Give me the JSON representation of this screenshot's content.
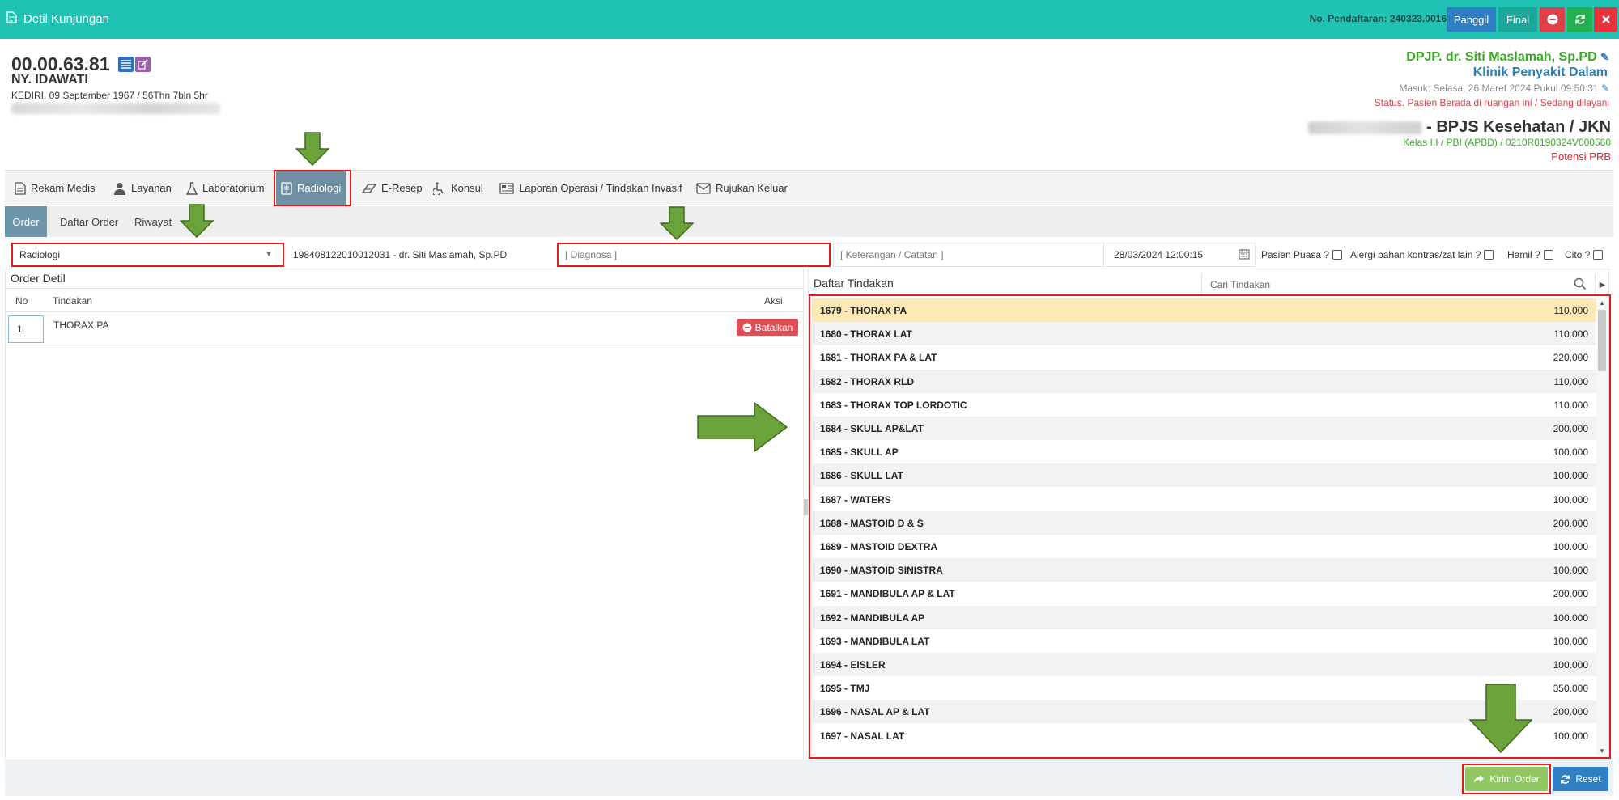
{
  "window": {
    "title": "Detil Kunjungan",
    "reg_label": "No. Pendaftaran: 240323.0016",
    "buttons": {
      "panggil": "Panggil",
      "final": "Final"
    }
  },
  "patient": {
    "rm": "00.00.63.81",
    "name": "NY. IDAWATI",
    "birth": "KEDIRI, 09 September 1967 / 56Thn 7bln 5hr"
  },
  "visit": {
    "dpjp": "DPJP. dr. Siti Maslamah, Sp.PD",
    "clinic": "Klinik Penyakit Dalam",
    "masuk": "Masuk: Selasa, 26 Maret 2024 Pukul 09:50:31",
    "status": "Status. Pasien Berada di ruangan ini / Sedang dilayani",
    "payer": "- BPJS Kesehatan / JKN",
    "kelas": "Kelas III / PBI (APBD) / 0210R0190324V000560",
    "prb": "Potensi PRB"
  },
  "tabs": [
    {
      "label": "Rekam Medis",
      "icon": "document-icon"
    },
    {
      "label": "Layanan",
      "icon": "user-doctor-icon"
    },
    {
      "label": "Laboratorium",
      "icon": "flask-icon"
    },
    {
      "label": "Radiologi",
      "icon": "xray-icon"
    },
    {
      "label": "E-Resep",
      "icon": "eraser-icon"
    },
    {
      "label": "Konsul",
      "icon": "wheelchair-icon"
    },
    {
      "label": "Laporan Operasi / Tindakan Invasif",
      "icon": "newspaper-icon"
    },
    {
      "label": "Rujukan Keluar",
      "icon": "envelope-icon"
    }
  ],
  "subtabs": [
    "Order",
    "Daftar Order",
    "Riwayat"
  ],
  "form": {
    "unit": "Radiologi",
    "doctor": "198408122010012031 - dr. Siti Maslamah, Sp.PD",
    "diagnosa_placeholder": "[ Diagnosa ]",
    "keterangan_placeholder": "[ Keterangan / Catatan ]",
    "datetime": "28/03/2024 12:00:15",
    "checks": [
      "Pasien Puasa ?",
      "Alergi bahan kontras/zat lain ?",
      "Hamil ?",
      "Cito ?"
    ]
  },
  "order": {
    "title": "Order Detil",
    "headers": {
      "no": "No",
      "tindakan": "Tindakan",
      "aksi": "Aksi"
    },
    "rows": [
      {
        "no": "1",
        "tindakan": "THORAX PA",
        "action": "Batalkan"
      }
    ]
  },
  "tindakan": {
    "title": "Daftar Tindakan",
    "search_placeholder": "Cari Tindakan",
    "items": [
      {
        "name": "1679 - THORAX PA",
        "price": "110.000"
      },
      {
        "name": "1680 - THORAX LAT",
        "price": "110.000"
      },
      {
        "name": "1681 - THORAX PA & LAT",
        "price": "220.000"
      },
      {
        "name": "1682 - THORAX RLD",
        "price": "110.000"
      },
      {
        "name": "1683 - THORAX TOP LORDOTIC",
        "price": "110.000"
      },
      {
        "name": "1684 - SKULL AP&LAT",
        "price": "200.000"
      },
      {
        "name": "1685 - SKULL AP",
        "price": "100.000"
      },
      {
        "name": "1686 - SKULL LAT",
        "price": "100.000"
      },
      {
        "name": "1687 - WATERS",
        "price": "100.000"
      },
      {
        "name": "1688 - MASTOID D & S",
        "price": "200.000"
      },
      {
        "name": "1689 - MASTOID DEXTRA",
        "price": "100.000"
      },
      {
        "name": "1690 - MASTOID SINISTRA",
        "price": "100.000"
      },
      {
        "name": "1691 - MANDIBULA AP & LAT",
        "price": "200.000"
      },
      {
        "name": "1692 - MANDIBULA AP",
        "price": "100.000"
      },
      {
        "name": "1693 - MANDIBULA LAT",
        "price": "100.000"
      },
      {
        "name": "1694 - EISLER",
        "price": "100.000"
      },
      {
        "name": "1695 - TMJ",
        "price": "350.000"
      },
      {
        "name": "1696 - NASAL AP & LAT",
        "price": "200.000"
      },
      {
        "name": "1697 - NASAL LAT",
        "price": "100.000"
      }
    ]
  },
  "footer": {
    "kirim": "Kirim Order",
    "reset": "Reset"
  },
  "colors": {
    "header": "#20c2b3",
    "highlight": "#e21b1b",
    "arrow": "#6aa33a",
    "selected_row": "#fde9b5"
  }
}
